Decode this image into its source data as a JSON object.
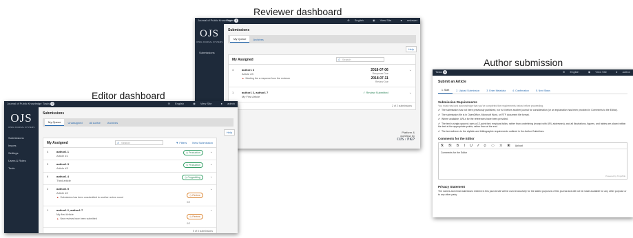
{
  "captions": {
    "reviewer": "Reviewer dashboard",
    "author": "Author submission",
    "editor": "Editor dashboard"
  },
  "common": {
    "site_name": "Journal of Public Knowledge",
    "tasks_label": "Tasks",
    "logo": "OJS",
    "logo_sub": "OPEN JOURNAL SYSTEMS",
    "topbar_right": [
      "English",
      "View Site",
      "reviewer"
    ],
    "help": "Help",
    "icons": [
      "search-icon",
      "chevron-down-icon",
      "warning-icon",
      "check-icon",
      "globe-icon",
      "eye-icon",
      "user-icon"
    ]
  },
  "editor": {
    "task_count": "0",
    "topbar_right": [
      "English",
      "View Site",
      "admin"
    ],
    "nav": [
      "Submissions",
      "Issues",
      "Settings",
      "Users & Roles",
      "Tools"
    ],
    "page_title": "Submissions",
    "tabs": [
      "My Queue",
      "Unassigned",
      "All Active",
      "Archives"
    ],
    "panel_title": "My Assigned",
    "search_placeholder": "Search",
    "filters": "Filters",
    "new_submission": "New Submission",
    "rows": [
      {
        "id": "4",
        "author": "author1 1",
        "title": "Article #1",
        "stage": "Production",
        "stage_color": "green",
        "warning": "",
        "count": ""
      },
      {
        "id": "3",
        "author": "author1 3",
        "title": "Article #3",
        "stage": "Production",
        "stage_color": "green",
        "warning": "",
        "count": ""
      },
      {
        "id": "6",
        "author": "author1 4",
        "title": "Third article",
        "stage": "Copyediting",
        "stage_color": "green",
        "warning": "",
        "count": ""
      },
      {
        "id": "2",
        "author": "author1 5",
        "title": "Article #2",
        "stage": "Review",
        "stage_color": "orange",
        "warning": "Submission has been unsubmitted to another review round",
        "count": "0/2"
      },
      {
        "id": "1",
        "author": "author1 2, author1 7",
        "title": "My first Article",
        "stage": "Review",
        "stage_color": "orange",
        "warning": "New reviews have been submitted",
        "count": "0/2"
      }
    ],
    "footer": "5 of 5 submissions"
  },
  "reviewer": {
    "task_count": "1",
    "nav": [
      "Submissions"
    ],
    "page_title": "Submissions",
    "tabs": [
      "My Queue",
      "Archives"
    ],
    "panel_title": "My Assigned",
    "search_placeholder": "Search",
    "rows": [
      {
        "id": "4",
        "author": "author1 3",
        "title": "Article #3",
        "warning": "Meeting the a response from the reviewer",
        "date1": "2018-07-06",
        "label1": "Response Due",
        "date2": "2018-07-11",
        "label2": "Review Due",
        "status": ""
      },
      {
        "id": "1",
        "author": "author1 2, author1 7",
        "title": "My First Article",
        "warning": "",
        "date1": "",
        "label1": "",
        "date2": "",
        "label2": "",
        "status": "Review Submitted"
      }
    ],
    "footer": "2 of 2 submissions",
    "brand_line1": "Platform &",
    "brand_line2": "workflow by",
    "brand_logo": "OJS / PKP"
  },
  "author": {
    "task_count": "0",
    "topbar_right": [
      "English",
      "View Site",
      "author"
    ],
    "page_title": "Submit an Article",
    "steps": [
      "1. Start",
      "2. Upload Submission",
      "3. Enter Metadata",
      "4. Confirmation",
      "5. Next Steps"
    ],
    "req_title": "Submission Requirements",
    "req_intro": "You must read and acknowledge that you've completed the requirements below before proceeding.",
    "requirements": [
      "The submission has not been previously published, nor is it before another journal for consideration (or an explanation has been provided in Comments to the Editor).",
      "The submission file is in OpenOffice, Microsoft Word, or RTF document file format.",
      "Where available, URLs for the references have been provided.",
      "The text is single-spaced; uses a 12-point font; employs italics, rather than underlining (except with URL addresses); and all illustrations, figures, and tables are placed within the text at the appropriate points, rather than at the end.",
      "The text adheres to the stylistic and bibliographic requirements outlined in the Author Guidelines."
    ],
    "comments_title": "Comments for the Editor",
    "editor_tools": "⎘ ⎘ B I U 𝓁 ⊘ ◇ ✕ ▣",
    "upload_label": "Upload",
    "comment_text": "Comments for the Editor",
    "powered": "Powered by TinyMCE",
    "privacy_title": "Privacy Statement",
    "privacy_text": "The names and email addresses entered in this journal site will be used exclusively for the stated purposes of this journal and will not be made available for any other purpose or to any other party."
  }
}
